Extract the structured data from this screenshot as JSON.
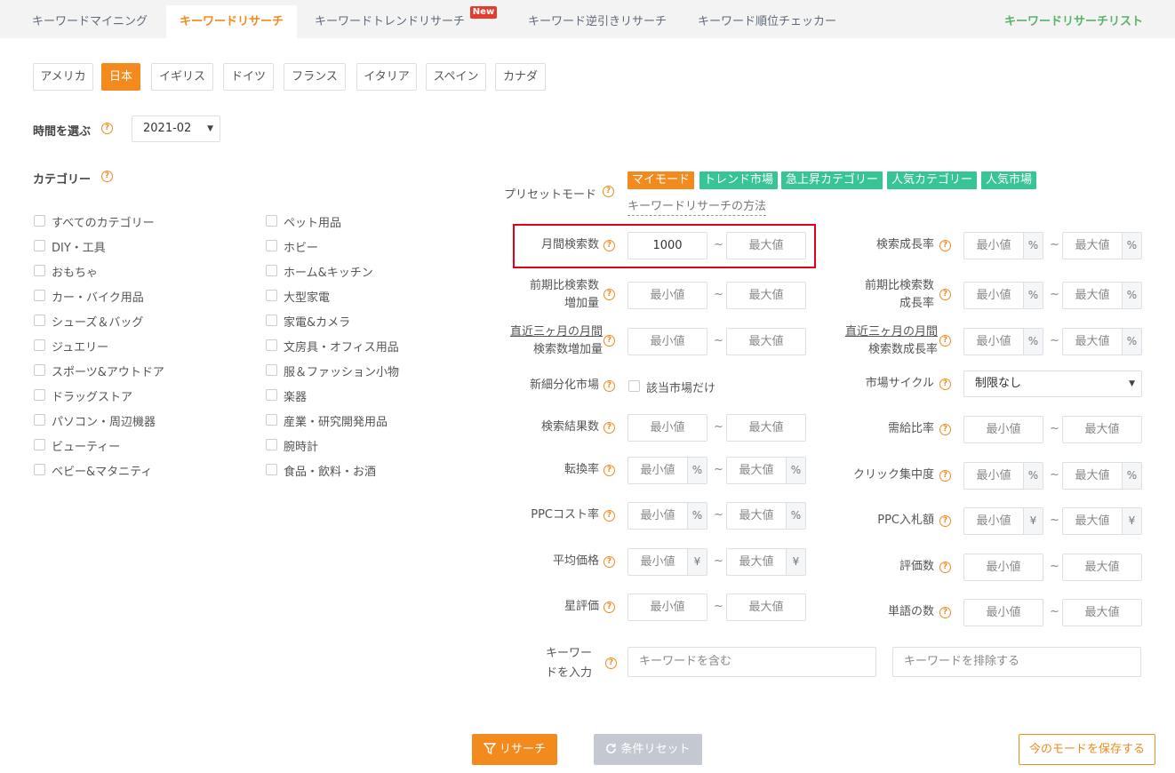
{
  "tabs": [
    {
      "label": "キーワードマイニング"
    },
    {
      "label": "キーワードリサーチ"
    },
    {
      "label": "キーワードトレンドリサーチ"
    },
    {
      "label": "キーワード逆引きリサーチ"
    },
    {
      "label": "キーワード順位チェッカー"
    }
  ],
  "new_badge": "New",
  "research_list_link": "キーワードリサーチリスト",
  "countries": [
    "アメリカ",
    "日本",
    "イギリス",
    "ドイツ",
    "フランス",
    "イタリア",
    "スペイン",
    "カナダ"
  ],
  "selected_country": "日本",
  "time": {
    "label": "時間を選ぶ",
    "value": "2021-02"
  },
  "category": {
    "label": "カテゴリー",
    "left": [
      "すべてのカテゴリー",
      "DIY・工具",
      "おもちゃ",
      "カー・バイク用品",
      "シューズ＆バッグ",
      "ジュエリー",
      "スポーツ&アウトドア",
      "ドラッグストア",
      "パソコン・周辺機器",
      "ビューティー",
      "ベビー&マタニティ"
    ],
    "right": [
      "ペット用品",
      "ホビー",
      "ホーム&キッチン",
      "大型家電",
      "家電&カメラ",
      "文房具・オフィス用品",
      "服＆ファッション小物",
      "楽器",
      "産業・研究開発用品",
      "腕時計",
      "食品・飲料・お酒"
    ]
  },
  "preset": {
    "label": "プリセットモード",
    "chips": [
      "マイモード",
      "トレンド市場",
      "急上昇カテゴリー",
      "人気カテゴリー",
      "人気市場"
    ],
    "method_link": "キーワードリサーチの方法"
  },
  "placeholders": {
    "min": "最小値",
    "max": "最大値"
  },
  "units": {
    "percent": "%",
    "yen": "¥"
  },
  "tilde": "~",
  "fields": {
    "monthly_search": {
      "label": "月間検索数",
      "min_value": "1000"
    },
    "search_growth": {
      "label": "検索成長率"
    },
    "prev_search_increase": {
      "line1": "前期比検索数",
      "line2": "増加量"
    },
    "prev_search_growth": {
      "line1": "前期比検索数",
      "line2": "成長率"
    },
    "three_month_increase": {
      "line1": "直近三ヶ月の月間",
      "line2": "検索数増加量"
    },
    "three_month_growth": {
      "line1": "直近三ヶ月の月間",
      "line2": "検索数成長率"
    },
    "new_market": {
      "label": "新細分化市場",
      "checkbox": "該当市場だけ"
    },
    "market_cycle": {
      "label": "市場サイクル",
      "value": "制限なし"
    },
    "search_results": {
      "label": "検索結果数"
    },
    "supply_demand": {
      "label": "需給比率"
    },
    "conversion": {
      "label": "転換率"
    },
    "click_concentration": {
      "label": "クリック集中度"
    },
    "ppc_cost": {
      "label": "PPCコスト率"
    },
    "ppc_bid": {
      "label": "PPC入札額"
    },
    "avg_price": {
      "label": "平均価格"
    },
    "reviews": {
      "label": "評価数"
    },
    "star_rating": {
      "label": "星評価"
    },
    "word_count": {
      "label": "単語の数"
    },
    "keyword": {
      "line1": "キーワー",
      "line2": "ドを入力",
      "include": "キーワードを含む",
      "exclude": "キーワードを排除する"
    }
  },
  "buttons": {
    "research": "リサーチ",
    "reset": "条件リセット",
    "save": "今のモードを保存する"
  },
  "colors": {
    "accent": "#f28a1e",
    "green": "#38c596",
    "link_green": "#58b368",
    "highlight": "#e3001b"
  }
}
